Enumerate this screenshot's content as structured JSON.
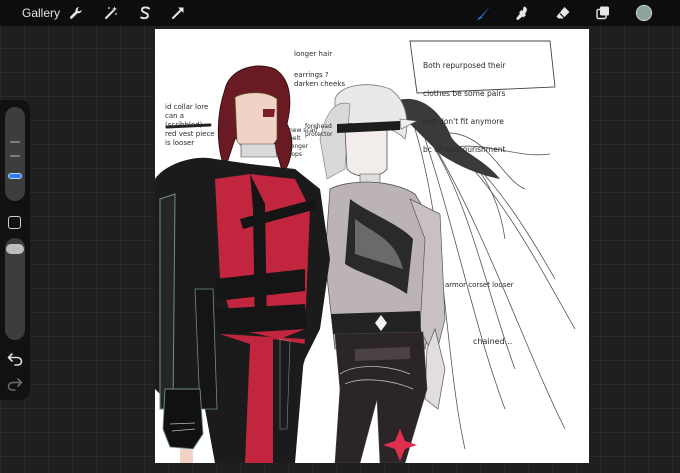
{
  "toolbar": {
    "gallery_label": "Gallery",
    "icons": [
      "wrench-icon",
      "magic-wand-icon",
      "selection-s-icon",
      "transform-arrow-icon",
      "brush-icon",
      "smudge-icon",
      "eraser-icon",
      "layers-icon",
      "color-swatch"
    ],
    "active_tool": "brush",
    "accent_color": "#2f7ef5",
    "current_color": "#8fa39d"
  },
  "sidebar": {
    "brush_size_fraction": 0.35,
    "opacity_fraction": 0.95
  },
  "canvas_notes": {
    "longer_hair": "longer hair",
    "earrings": "earrings ?\ndarken cheeks",
    "collar": "id collar lore\ncan a\n(scribbled)\nred vest piece\nis looser",
    "mid_left": "new scarf\nbelt\nlonger\ntops",
    "mid_right": "forehead\nprotector",
    "box_line1": "Both repurposed their",
    "box_line2": "clothes be some pairs",
    "box_line3": "just don't fit anymore",
    "box_line4": "bc of malnourishment",
    "armor": "armor corset looser",
    "chained": "chained..."
  }
}
